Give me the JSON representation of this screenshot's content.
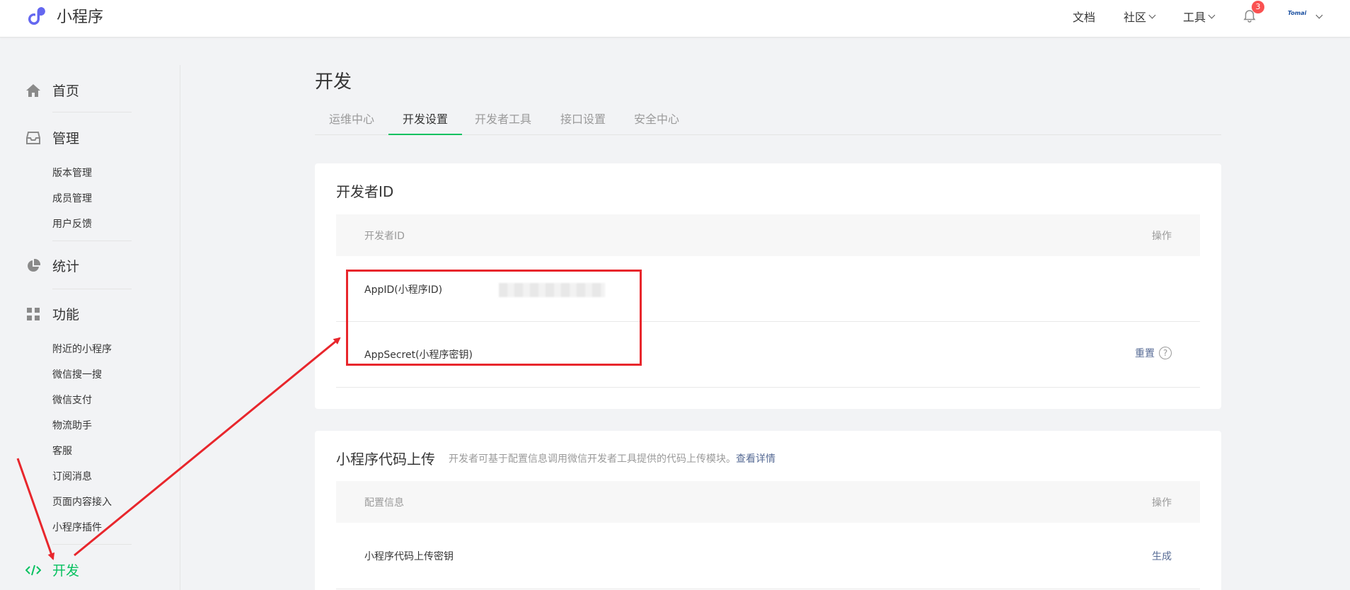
{
  "app": {
    "title": "小程序"
  },
  "topnav": {
    "docs": "文档",
    "community": "社区",
    "tools": "工具",
    "notifications": {
      "count": "3"
    },
    "avatar_text": "Tomai"
  },
  "sidebar": {
    "home": "首页",
    "manage": "管理",
    "manage_items": [
      "版本管理",
      "成员管理",
      "用户反馈"
    ],
    "stats": "统计",
    "features": "功能",
    "feature_items": [
      "附近的小程序",
      "微信搜一搜",
      "微信支付",
      "物流助手",
      "客服",
      "订阅消息",
      "页面内容接入",
      "小程序插件"
    ],
    "dev": "开发"
  },
  "main": {
    "title": "开发",
    "tabs": [
      {
        "label": "运维中心"
      },
      {
        "label": "开发设置",
        "active": true
      },
      {
        "label": "开发者工具"
      },
      {
        "label": "接口设置"
      },
      {
        "label": "安全中心"
      }
    ],
    "dev_id_card": {
      "title": "开发者ID",
      "col_left": "开发者ID",
      "col_right": "操作",
      "rows": [
        {
          "label": "AppID(小程序ID)"
        },
        {
          "label": "AppSecret(小程序密钥)",
          "action": "重置",
          "help": "?"
        }
      ]
    },
    "upload_card": {
      "title": "小程序代码上传",
      "desc": "开发者可基于配置信息调用微信开发者工具提供的代码上传模块。",
      "link": "查看详情",
      "col_left": "配置信息",
      "col_right": "操作",
      "rows": [
        {
          "label": "小程序代码上传密钥",
          "action": "生成"
        }
      ]
    }
  },
  "colors": {
    "accent": "#07c160",
    "link": "#576b95",
    "annotation": "#e8262c"
  }
}
